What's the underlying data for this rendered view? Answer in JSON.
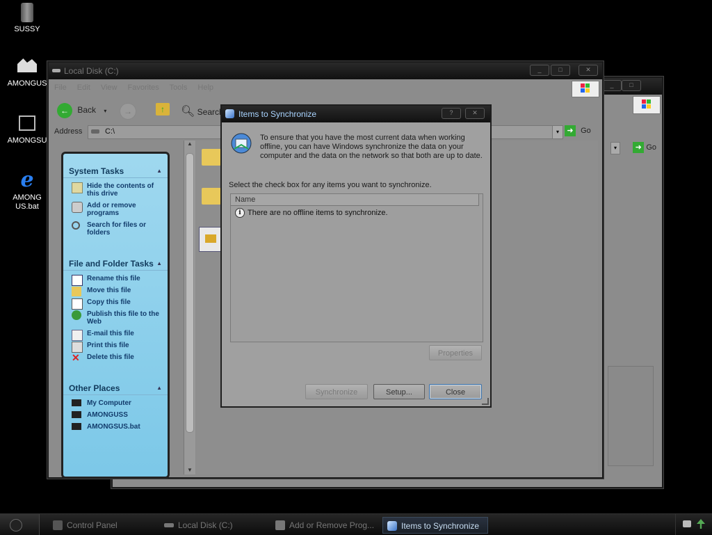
{
  "desktop": {
    "icons": [
      {
        "label": "SUSSY",
        "icon": "trash-can-icon"
      },
      {
        "label": "AMONGUS",
        "icon": "drive-icon"
      },
      {
        "label": "AMONGSU",
        "icon": "network-computer-icon"
      },
      {
        "label": "AMONG US.bat",
        "icon": "internet-explorer-icon"
      }
    ]
  },
  "explorer": {
    "title": "Local Disk (C:)",
    "menu": [
      "File",
      "Edit",
      "View",
      "Favorites",
      "Tools",
      "Help"
    ],
    "toolbar": {
      "back_label": "Back",
      "search_label": "Search"
    },
    "address": {
      "label": "Address",
      "value": "C:\\",
      "go_label": "Go"
    },
    "tasks": {
      "system": {
        "title": "System Tasks",
        "items": [
          "Hide the contents of this drive",
          "Add or remove programs",
          "Search for files or folders"
        ]
      },
      "file_folder": {
        "title": "File and Folder Tasks",
        "items": [
          "Rename this file",
          "Move this file",
          "Copy this file",
          "Publish this file to the Web",
          "E-mail this file",
          "Print this file",
          "Delete this file"
        ]
      },
      "other_places": {
        "title": "Other Places",
        "items": [
          "My Computer",
          "AMONGUSS",
          "AMONGSUS.bat"
        ]
      }
    }
  },
  "back_window": {
    "go_label": "Go"
  },
  "dialog": {
    "title": "Items to Synchronize",
    "intro": "To ensure that you have the most current data when working offline, you can have Windows synchronize the data on your computer and the data on the network so that both are up to date.",
    "instruction": "Select the check box for any items you want to synchronize.",
    "column_name": "Name",
    "empty_message": "There are no offline items to synchronize.",
    "buttons": {
      "properties": "Properties",
      "synchronize": "Synchronize",
      "setup": "Setup...",
      "close": "Close"
    }
  },
  "taskbar": {
    "items": [
      {
        "label": "Control Panel",
        "active": false
      },
      {
        "label": "Local Disk (C:)",
        "active": false
      },
      {
        "label": "Add or Remove Prog...",
        "active": false
      },
      {
        "label": "Items to Synchronize",
        "active": true
      }
    ]
  }
}
